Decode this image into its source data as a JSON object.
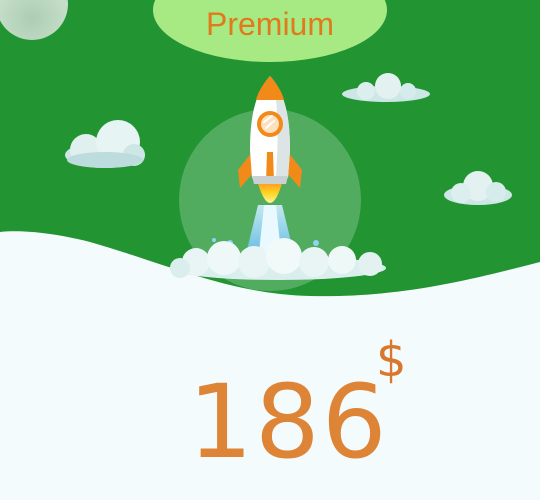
{
  "plan": {
    "name": "Premium",
    "price": "186",
    "currency_symbol": "$"
  },
  "colors": {
    "hero_green": "#229532",
    "badge_green": "#a7ea83",
    "accent_orange": "#de8436",
    "page_background": "#f4fbfd"
  },
  "icons": [
    "rocket-icon",
    "cloud-icon"
  ]
}
